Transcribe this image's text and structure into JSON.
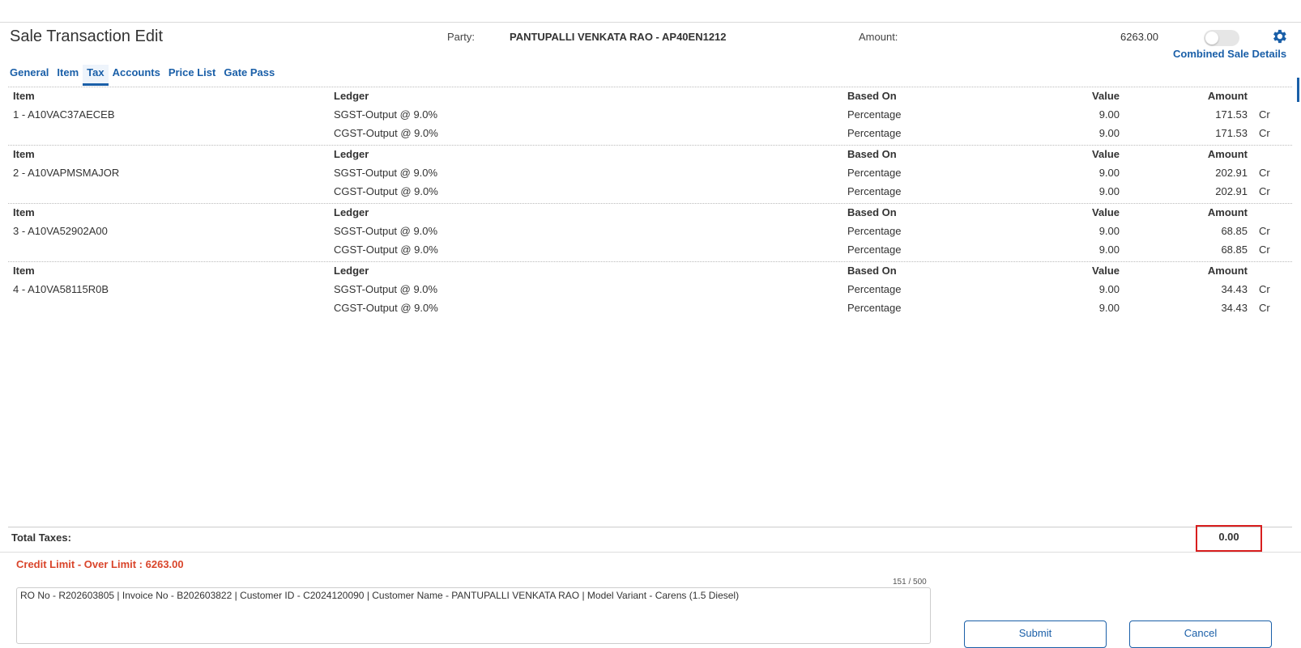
{
  "header": {
    "title": "Sale Transaction Edit",
    "party_label": "Party:",
    "party_value": "PANTUPALLI VENKATA RAO - AP40EN1212",
    "amount_label": "Amount:",
    "amount_value": "6263.00",
    "combined_link": "Combined Sale Details",
    "settings_icon": "gear-icon",
    "accent_color": "#1a5fa8"
  },
  "tabs": [
    {
      "label": "General"
    },
    {
      "label": "Item"
    },
    {
      "label": "Tax",
      "active": true
    },
    {
      "label": "Accounts"
    },
    {
      "label": "Price List"
    },
    {
      "label": "Gate Pass"
    }
  ],
  "columns": {
    "item": "Item",
    "ledger": "Ledger",
    "based_on": "Based On",
    "value": "Value",
    "amount": "Amount"
  },
  "groups": [
    {
      "item": "1 - A10VAC37AECEB",
      "rows": [
        {
          "ledger": "SGST-Output @ 9.0%",
          "based_on": "Percentage",
          "value": "9.00",
          "amount": "171.53",
          "drcr": "Cr"
        },
        {
          "ledger": "CGST-Output @ 9.0%",
          "based_on": "Percentage",
          "value": "9.00",
          "amount": "171.53",
          "drcr": "Cr"
        }
      ]
    },
    {
      "item": "2 - A10VAPMSMAJOR",
      "rows": [
        {
          "ledger": "SGST-Output @ 9.0%",
          "based_on": "Percentage",
          "value": "9.00",
          "amount": "202.91",
          "drcr": "Cr"
        },
        {
          "ledger": "CGST-Output @ 9.0%",
          "based_on": "Percentage",
          "value": "9.00",
          "amount": "202.91",
          "drcr": "Cr"
        }
      ]
    },
    {
      "item": "3 - A10VA52902A00",
      "rows": [
        {
          "ledger": "SGST-Output @ 9.0%",
          "based_on": "Percentage",
          "value": "9.00",
          "amount": "68.85",
          "drcr": "Cr"
        },
        {
          "ledger": "CGST-Output @ 9.0%",
          "based_on": "Percentage",
          "value": "9.00",
          "amount": "68.85",
          "drcr": "Cr"
        }
      ]
    },
    {
      "item": "4 - A10VA58115R0B",
      "rows": [
        {
          "ledger": "SGST-Output @ 9.0%",
          "based_on": "Percentage",
          "value": "9.00",
          "amount": "34.43",
          "drcr": "Cr"
        },
        {
          "ledger": "CGST-Output @ 9.0%",
          "based_on": "Percentage",
          "value": "9.00",
          "amount": "34.43",
          "drcr": "Cr"
        }
      ]
    }
  ],
  "totals": {
    "label": "Total Taxes:",
    "value": "0.00",
    "highlight_color": "#d81e1e"
  },
  "credit": {
    "text": "Credit Limit - Over Limit : 6263.00",
    "color": "#d9452b"
  },
  "remarks": {
    "counter": "151 / 500",
    "value": "RO No - R202603805 | Invoice No - B202603822 | Customer ID - C2024120090 | Customer Name - PANTUPALLI VENKATA RAO | Model Variant - Carens (1.5 Diesel)"
  },
  "buttons": {
    "submit": "Submit",
    "cancel": "Cancel"
  }
}
